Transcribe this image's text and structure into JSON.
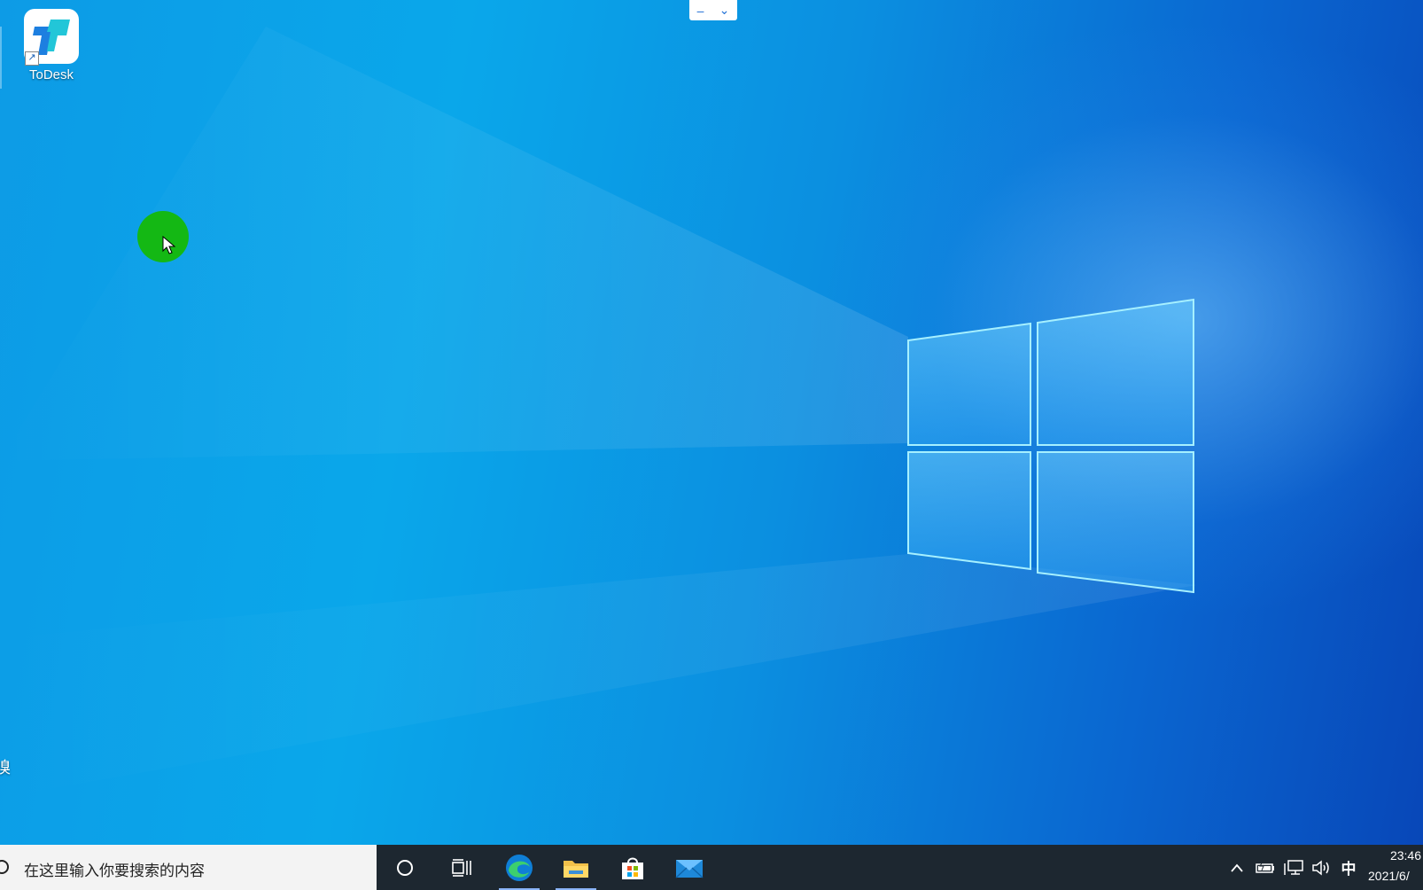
{
  "desktop": {
    "icons": [
      {
        "label": "ToDesk",
        "icon": "todesk-app-icon"
      }
    ],
    "left_edge_fragment": "嗅",
    "wallpaper": "windows-10-light-blue-logo"
  },
  "remote_toolbar": {
    "minimize_glyph": "–",
    "expand_glyph": "⌄"
  },
  "taskbar": {
    "search_placeholder": "在这里输入你要搜索的内容",
    "pinned": [
      {
        "name": "cortana",
        "icon": "cortana-circle-icon"
      },
      {
        "name": "task-view",
        "icon": "task-view-icon"
      },
      {
        "name": "edge",
        "icon": "edge-browser-icon"
      },
      {
        "name": "file-explorer",
        "icon": "folder-icon"
      },
      {
        "name": "microsoft-store",
        "icon": "store-bag-icon"
      },
      {
        "name": "mail",
        "icon": "mail-envelope-icon"
      }
    ],
    "tray": {
      "chevron": "^",
      "ime_label": "中",
      "clock_time": "23:46",
      "clock_date": "2021/6/"
    }
  },
  "colors": {
    "taskbar_bg": "#1d2730",
    "search_bg": "#f3f3f3",
    "click_marker": "#14b814",
    "wallpaper_left": "#0aa7ea",
    "wallpaper_right": "#0847b8"
  }
}
